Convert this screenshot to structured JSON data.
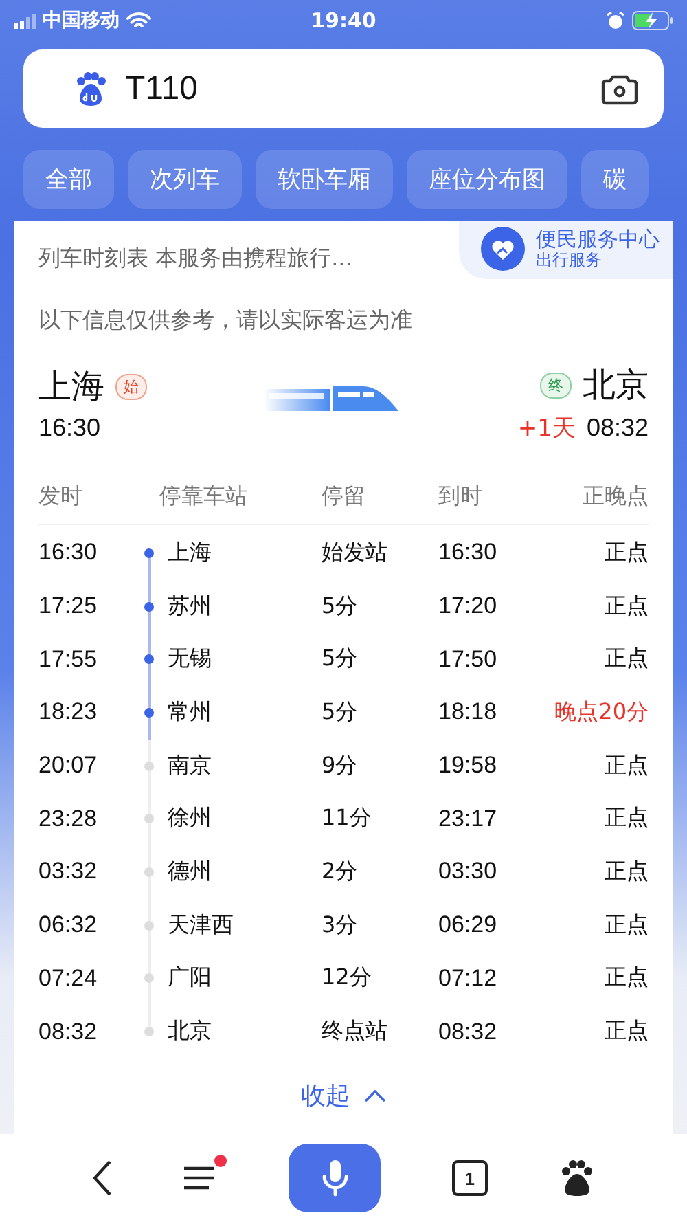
{
  "status_bar": {
    "carrier": "中国移动",
    "time": "19:40"
  },
  "search": {
    "value": "T110"
  },
  "tabs": [
    {
      "label": "全部",
      "selected": false
    },
    {
      "label": "次列车",
      "selected": false
    },
    {
      "label": "软卧车厢",
      "selected": false
    },
    {
      "label": "座位分布图",
      "selected": false
    },
    {
      "label": "碳",
      "selected": false
    }
  ],
  "card": {
    "subtitle": "列车时刻表 本服务由携程旅行...",
    "service": {
      "title": "便民服务中心",
      "subtitle": "出行服务"
    },
    "notice": "以下信息仅供参考，请以实际客运为准",
    "from": {
      "station": "上海",
      "tag": "始",
      "time": "16:30"
    },
    "to": {
      "station": "北京",
      "tag": "终",
      "day_offset": "+1天",
      "time": "08:32"
    },
    "columns": [
      "发时",
      "停靠车站",
      "停留",
      "到时",
      "正晚点"
    ],
    "rows": [
      {
        "depart": "16:30",
        "station": "上海",
        "stop": "始发站",
        "arrive": "16:30",
        "status": "正点",
        "passed": true,
        "late": false
      },
      {
        "depart": "17:25",
        "station": "苏州",
        "stop": "5分",
        "arrive": "17:20",
        "status": "正点",
        "passed": true,
        "late": false
      },
      {
        "depart": "17:55",
        "station": "无锡",
        "stop": "5分",
        "arrive": "17:50",
        "status": "正点",
        "passed": true,
        "late": false
      },
      {
        "depart": "18:23",
        "station": "常州",
        "stop": "5分",
        "arrive": "18:18",
        "status": "晚点20分",
        "passed": true,
        "late": true
      },
      {
        "depart": "20:07",
        "station": "南京",
        "stop": "9分",
        "arrive": "19:58",
        "status": "正点",
        "passed": false,
        "late": false
      },
      {
        "depart": "23:28",
        "station": "徐州",
        "stop": "11分",
        "arrive": "23:17",
        "status": "正点",
        "passed": false,
        "late": false
      },
      {
        "depart": "03:32",
        "station": "德州",
        "stop": "2分",
        "arrive": "03:30",
        "status": "正点",
        "passed": false,
        "late": false
      },
      {
        "depart": "06:32",
        "station": "天津西",
        "stop": "3分",
        "arrive": "06:29",
        "status": "正点",
        "passed": false,
        "late": false
      },
      {
        "depart": "07:24",
        "station": "广阳",
        "stop": "12分",
        "arrive": "07:12",
        "status": "正点",
        "passed": false,
        "late": false
      },
      {
        "depart": "08:32",
        "station": "北京",
        "stop": "终点站",
        "arrive": "08:32",
        "status": "正点",
        "passed": false,
        "late": false
      }
    ],
    "collapse": "收起"
  },
  "bottom_nav": {
    "tab_count": "1",
    "menu_badge": true
  }
}
